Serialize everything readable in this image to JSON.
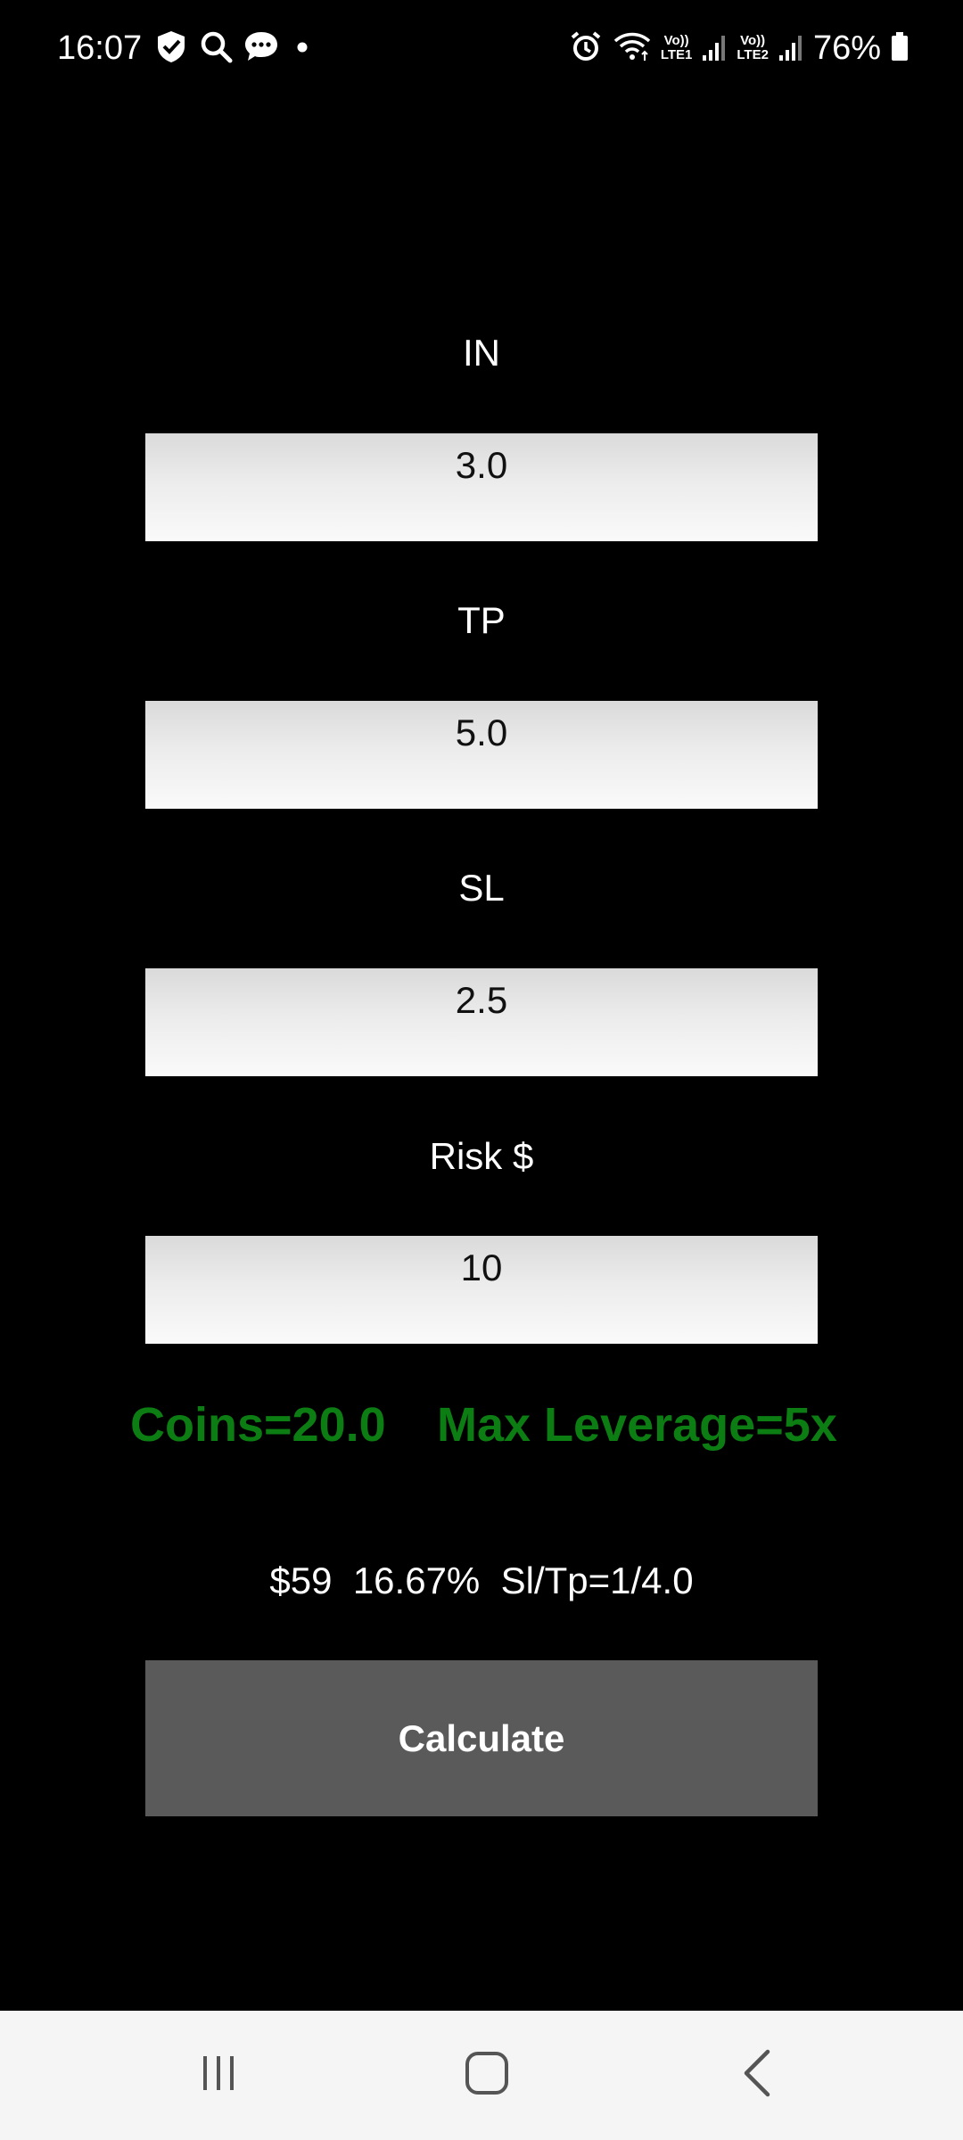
{
  "status_bar": {
    "time": "16:07",
    "left_icons": [
      "shield-check-icon",
      "search-icon",
      "chat-bubble-icon",
      "dot-icon"
    ],
    "right_icons": [
      "alarm-icon",
      "wifi-icon",
      "signal-1-icon",
      "signal-2-icon",
      "battery-icon"
    ],
    "lte1_top": "Vo))",
    "lte1_bottom": "LTE1",
    "lte2_top": "Vo))",
    "lte2_bottom": "LTE2",
    "battery": "76%"
  },
  "form": {
    "in_label": "IN",
    "in_value": "3.0",
    "tp_label": "TP",
    "tp_value": "5.0",
    "sl_label": "SL",
    "sl_value": "2.5",
    "risk_label": "Risk $",
    "risk_value": "10"
  },
  "results": {
    "coins": "Coins=20.0",
    "max_leverage": "Max Leverage=5x",
    "summary": "$59  16.67%  Sl/Tp=1/4.0",
    "accent_color": "#0c7d12"
  },
  "actions": {
    "calculate_label": "Calculate"
  },
  "nav": {
    "items": [
      "recent-apps-icon",
      "home-icon",
      "back-icon"
    ]
  }
}
